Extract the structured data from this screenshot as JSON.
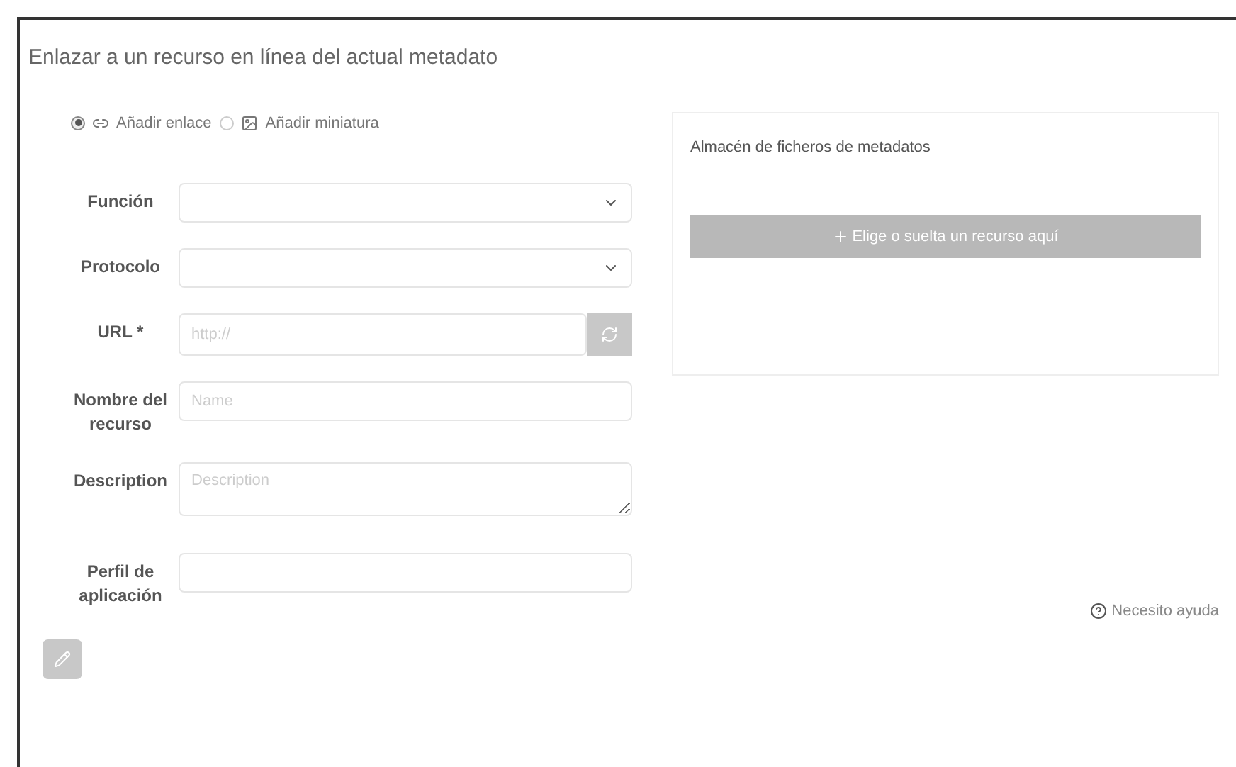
{
  "dialog": {
    "title": "Enlazar a un recurso en línea del actual metadato"
  },
  "modes": [
    {
      "label": "Añadir enlace",
      "selected": true
    },
    {
      "label": "Añadir miniatura",
      "selected": false
    }
  ],
  "fields": [
    {
      "label": "Función",
      "kind": "select"
    },
    {
      "label": "Protocolo",
      "kind": "select"
    },
    {
      "label": "URL *",
      "kind": "url",
      "placeholder": "http://"
    },
    {
      "label": "Nombre del recurso",
      "kind": "input",
      "placeholder": "Name"
    },
    {
      "label": "Description",
      "kind": "textarea",
      "placeholder": "Description"
    },
    {
      "label": "Perfil de aplicación",
      "kind": "input"
    }
  ],
  "store": {
    "title": "Almacén de ficheros de metadatos",
    "drop_button": "Elige o suelta un recurso aquí"
  },
  "help_link": "Necesito ayuda"
}
